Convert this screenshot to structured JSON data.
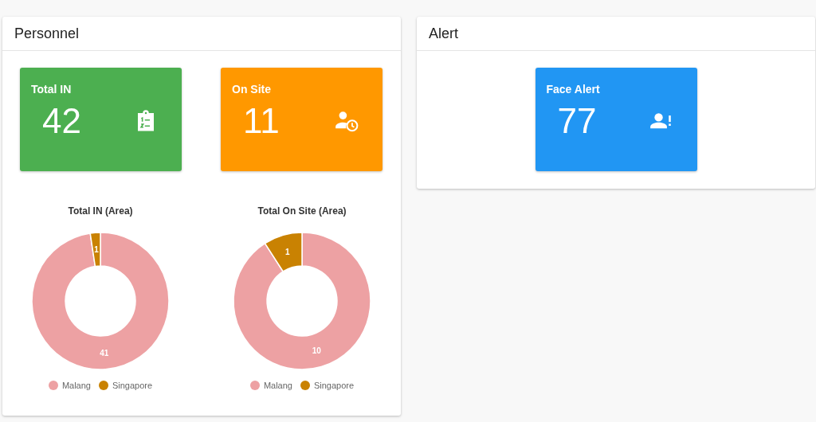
{
  "panels": [
    {
      "title": "Personnel",
      "cards": [
        {
          "label": "Total IN",
          "value": "42",
          "color": "#4caf50"
        },
        {
          "label": "On Site",
          "value": "11",
          "color": "#ff9800"
        }
      ],
      "charts": [
        {
          "chart_data": {
            "type": "donut",
            "title": "Total IN (Area)",
            "categories": [
              "Malang",
              "Singapore"
            ],
            "series": [
              {
                "colors": [
                  "#eda1a3",
                  "#c98202"
                ],
                "values": [
                  41,
                  1
                ]
              }
            ],
            "data_labels": true,
            "legend": true
          }
        },
        {
          "chart_data": {
            "type": "donut",
            "title": "Total On Site (Area)",
            "categories": [
              "Malang",
              "Singapore"
            ],
            "series": [
              {
                "colors": [
                  "#eda1a3",
                  "#c98202"
                ],
                "values": [
                  10,
                  1
                ]
              }
            ],
            "data_labels": true,
            "legend": true
          }
        }
      ]
    },
    {
      "title": "Alert",
      "cards": [
        {
          "label": "Face Alert",
          "value": "77",
          "color": "#2196f3"
        }
      ]
    }
  ]
}
